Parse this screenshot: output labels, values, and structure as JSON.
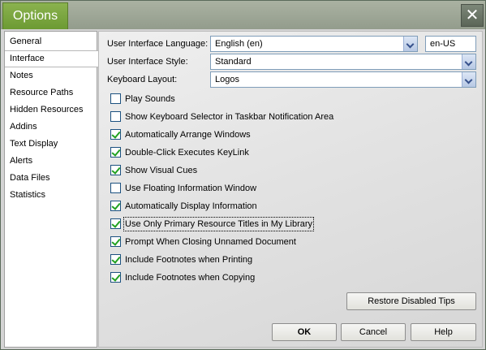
{
  "window": {
    "title": "Options",
    "close_glyph": "✕"
  },
  "nav": {
    "items": [
      {
        "label": "General",
        "selected": false
      },
      {
        "label": "Interface",
        "selected": true
      },
      {
        "label": "Notes",
        "selected": false
      },
      {
        "label": "Resource Paths",
        "selected": false
      },
      {
        "label": "Hidden Resources",
        "selected": false
      },
      {
        "label": "Addins",
        "selected": false
      },
      {
        "label": "Text Display",
        "selected": false
      },
      {
        "label": "Alerts",
        "selected": false
      },
      {
        "label": "Data Files",
        "selected": false
      },
      {
        "label": "Statistics",
        "selected": false
      }
    ]
  },
  "interface": {
    "language_label": "User Interface Language:",
    "language_value": "English (en)",
    "locale_value": "en-US",
    "style_label": "User Interface Style:",
    "style_value": "Standard",
    "keyboard_label": "Keyboard Layout:",
    "keyboard_value": "Logos",
    "checkboxes": [
      {
        "label": "Play Sounds",
        "checked": false
      },
      {
        "label": "Show Keyboard Selector in Taskbar Notification Area",
        "checked": false
      },
      {
        "label": "Automatically Arrange Windows",
        "checked": true
      },
      {
        "label": "Double-Click Executes KeyLink",
        "checked": true
      },
      {
        "label": "Show Visual Cues",
        "checked": true
      },
      {
        "label": "Use Floating Information Window",
        "checked": false
      },
      {
        "label": "Automatically Display Information",
        "checked": true
      },
      {
        "label": "Use Only Primary Resource Titles in My Library",
        "checked": true,
        "focused": true
      },
      {
        "label": "Prompt When Closing Unnamed Document",
        "checked": true
      },
      {
        "label": "Include Footnotes when Printing",
        "checked": true
      },
      {
        "label": "Include Footnotes when Copying",
        "checked": true
      }
    ]
  },
  "buttons": {
    "restore_label": "Restore Disabled Tips",
    "ok_label": "OK",
    "cancel_label": "Cancel",
    "help_label": "Help"
  },
  "icons": {
    "dropdown": "chevron-down-icon",
    "close": "close-icon",
    "check": "checkmark-icon"
  },
  "colors": {
    "title_tab": "#7aa63f",
    "titlebar": "#9ea596",
    "checkmark": "#21a121"
  }
}
